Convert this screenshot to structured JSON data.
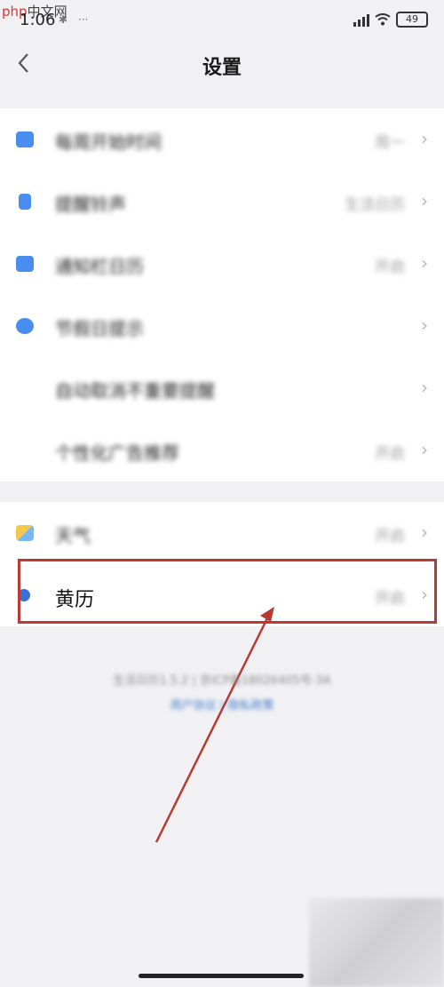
{
  "status_bar": {
    "watermark_text": "php",
    "watermark_cn": "中文网",
    "time": "1:06",
    "battery": "49"
  },
  "header": {
    "back_icon": "chevron-left",
    "title": "设置"
  },
  "group1": [
    {
      "icon": "calendar-icon",
      "icon_color": "#4a8df0",
      "label": "每周开始时间",
      "value": "周一",
      "chevron": true
    },
    {
      "icon": "bell-icon",
      "icon_color": "#4a8df0",
      "label": "提醒铃声",
      "value": "生活日历",
      "chevron": true
    },
    {
      "icon": "notification-bar-icon",
      "icon_color": "#4a8df0",
      "label": "通知栏日历",
      "value": "开启",
      "chevron": true
    },
    {
      "icon": "holiday-icon",
      "icon_color": "#4a8df0",
      "label": "节假日提示",
      "value": "",
      "chevron": true
    },
    {
      "icon": "",
      "icon_color": "",
      "label": "自动取消不重要提醒",
      "value": "",
      "chevron": true
    },
    {
      "icon": "",
      "icon_color": "",
      "label": "个性化广告推荐",
      "value": "开启",
      "chevron": true
    }
  ],
  "group2": [
    {
      "icon": "weather-icon",
      "icon_color": "#f2c94c",
      "label": "天气",
      "value": "开启",
      "chevron": true
    },
    {
      "icon": "almanac-icon",
      "icon_color": "#3a6fd8",
      "label": "黄历",
      "value": "开启",
      "chevron": true
    }
  ],
  "footer": {
    "line1": "生活日历1.5.2 | 京ICP备18026405号-3A",
    "links": "用户协议 | 隐私政策"
  },
  "colors": {
    "highlight": "#b83a33",
    "link": "#3f7ac9"
  }
}
